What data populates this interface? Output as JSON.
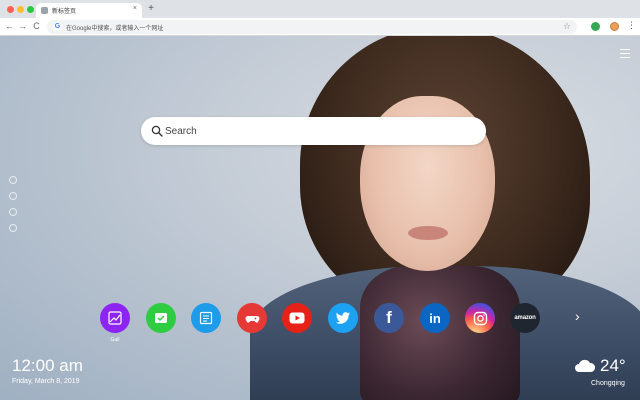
{
  "browser": {
    "tab_title": "新标签页",
    "tab_close": "×",
    "new_tab": "+",
    "back": "←",
    "forward": "→",
    "reload": "C",
    "omnibox_text": "在Google中搜索，或者输入一个网址",
    "google_logo": "G",
    "bookmark_star": "☆",
    "menu": "⋮"
  },
  "search": {
    "placeholder": "Search"
  },
  "shortcuts": [
    {
      "name": "gallery",
      "label": "",
      "color": "#8e24f2",
      "icon": "image-icon"
    },
    {
      "name": "tasks",
      "label": "",
      "color": "#2ecc40",
      "icon": "check-icon"
    },
    {
      "name": "notes",
      "label": "",
      "color": "#1e9be9",
      "icon": "note-icon"
    },
    {
      "name": "games",
      "label": "",
      "color": "#e53935",
      "icon": "gamepad-icon"
    },
    {
      "name": "youtube",
      "label": "",
      "color": "#e62117",
      "icon": "youtube-icon"
    },
    {
      "name": "twitter",
      "label": "",
      "color": "#1da1f2",
      "icon": "twitter-icon"
    },
    {
      "name": "facebook",
      "label": "f",
      "color": "#3b5998",
      "icon": "facebook-icon"
    },
    {
      "name": "linkedin",
      "label": "in",
      "color": "#0a66c2",
      "icon": "linkedin-icon"
    },
    {
      "name": "instagram",
      "label": "",
      "color": "#d62976",
      "icon": "instagram-icon"
    },
    {
      "name": "amazon",
      "label": "amazon",
      "color": "#1f2630",
      "icon": "amazon-icon"
    }
  ],
  "shortcut_caption": "Gall",
  "next_arrow": "›",
  "clock": {
    "time": "12:00 am",
    "date": "Friday, March 8, 2019"
  },
  "weather": {
    "temperature": "24°",
    "city": "Chongqing",
    "icon": "cloud-icon"
  }
}
